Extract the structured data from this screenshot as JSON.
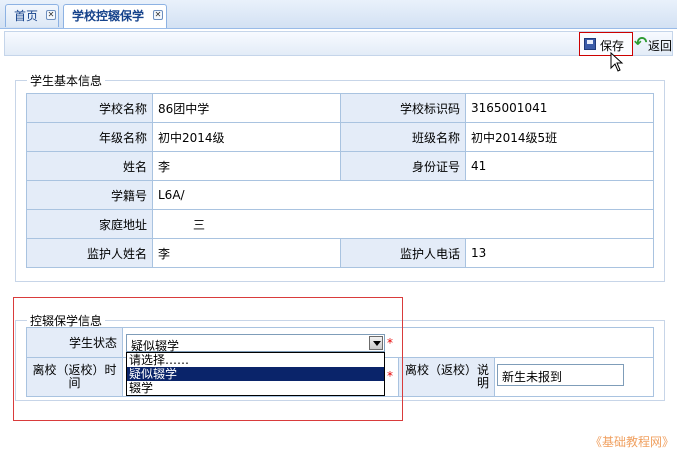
{
  "tabs": [
    {
      "label": "首页",
      "active": false
    },
    {
      "label": "学校控辍保学",
      "active": true
    }
  ],
  "toolbar": {
    "save_label": "保存",
    "back_label": "返回"
  },
  "basic_info": {
    "legend": "学生基本信息",
    "rows": [
      [
        {
          "label": "学校名称",
          "value": "86团中学"
        },
        {
          "label": "学校标识码",
          "value": "3165001041"
        }
      ],
      [
        {
          "label": "年级名称",
          "value": "初中2014级"
        },
        {
          "label": "班级名称",
          "value": "初中2014级5班"
        }
      ],
      [
        {
          "label": "姓名",
          "value": "李"
        },
        {
          "label": "身份证号",
          "value": "41"
        }
      ],
      [
        {
          "label": "学籍号",
          "value": "L6A/"
        }
      ],
      [
        {
          "label": "家庭地址",
          "value": "三"
        }
      ],
      [
        {
          "label": "监护人姓名",
          "value": "李"
        },
        {
          "label": "监护人电话",
          "value": "13"
        }
      ]
    ]
  },
  "control": {
    "legend": "控辍保学信息",
    "status_label": "学生状态",
    "status_value": "疑似辍学",
    "status_options": [
      "请选择……",
      "疑似辍学",
      "辍学"
    ],
    "selected_option_index": 1,
    "time_label": "离校（返校）时间",
    "note_label": "离校（返校）说明",
    "note_value": "新生未报到",
    "required_mark": "*"
  },
  "watermark": "《基础教程网》",
  "colors": {
    "label_bg": "#e4ecf8",
    "border": "#a9c3e0",
    "highlight": "#d93b3b",
    "selection": "#0a246a"
  }
}
